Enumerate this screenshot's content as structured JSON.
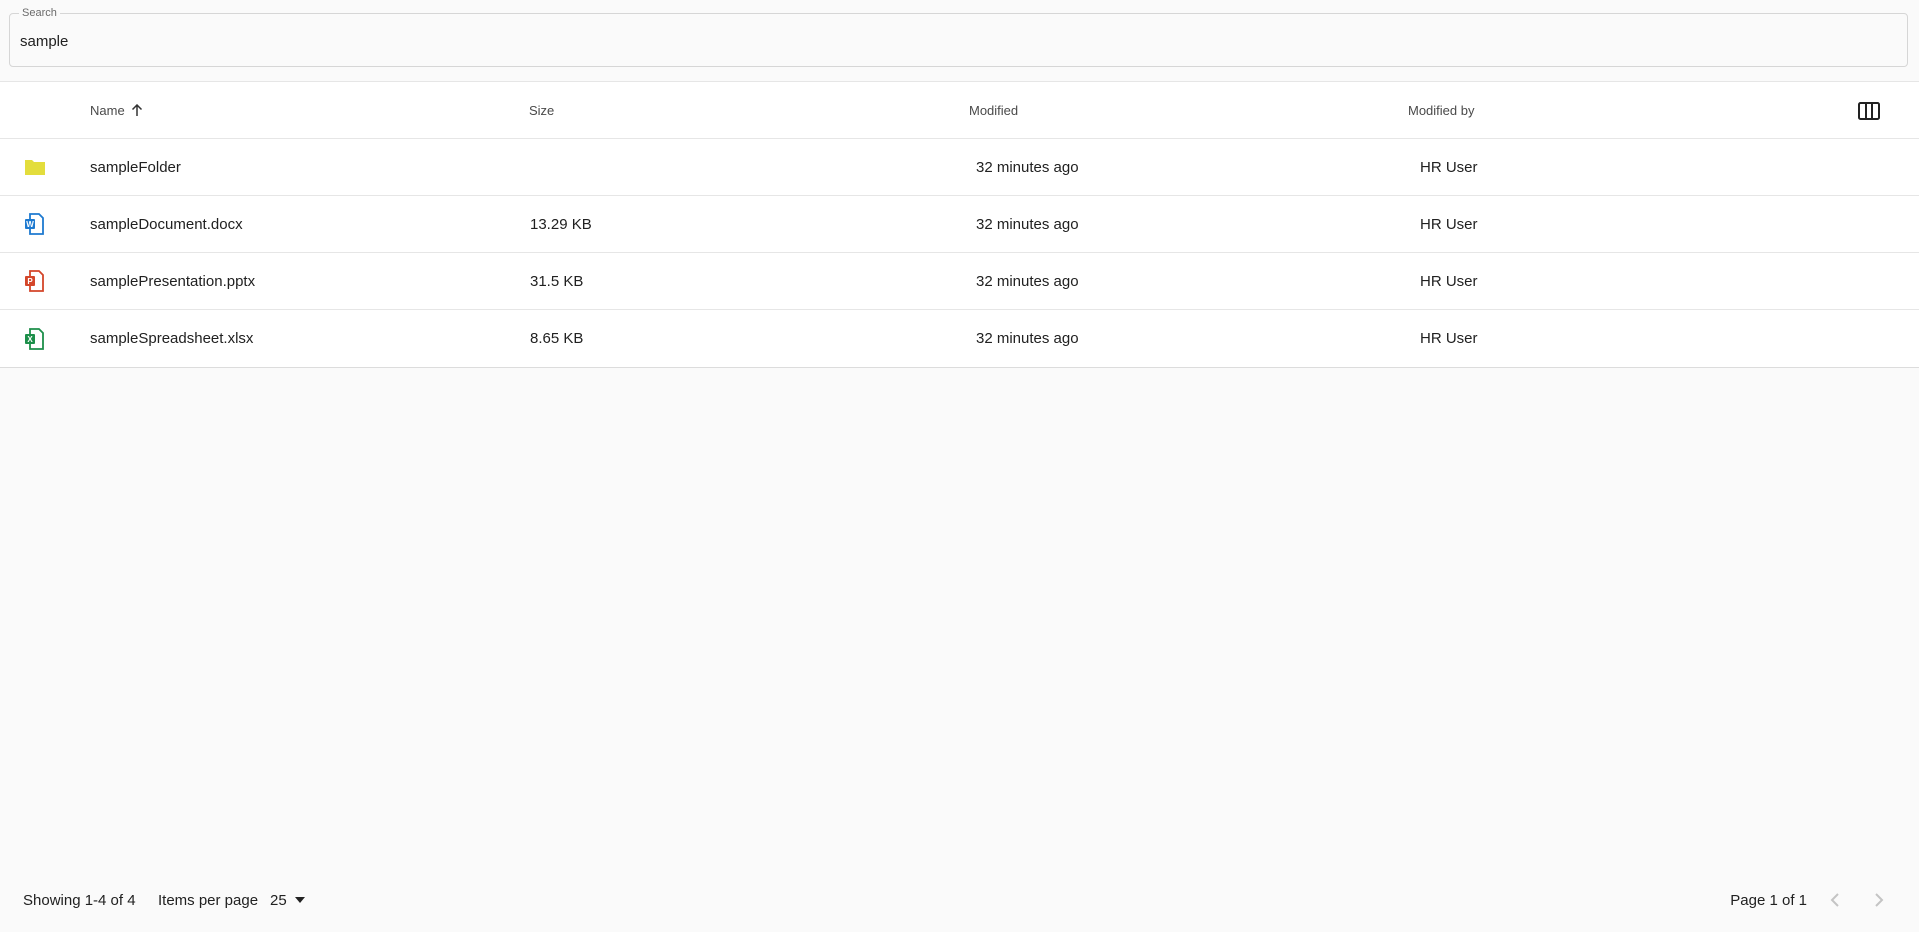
{
  "search": {
    "label": "Search",
    "value": "sample"
  },
  "table": {
    "columns": {
      "name": "Name",
      "size": "Size",
      "modified": "Modified",
      "modified_by": "Modified by"
    },
    "sort": {
      "column": "Name",
      "direction": "ascending"
    },
    "rows": [
      {
        "icon": "folder-icon",
        "name": "sampleFolder",
        "size": "",
        "modified": "32 minutes ago",
        "modified_by": "HR User"
      },
      {
        "icon": "word-document-icon",
        "name": "sampleDocument.docx",
        "size": "13.29 KB",
        "modified": "32 minutes ago",
        "modified_by": "HR User"
      },
      {
        "icon": "powerpoint-icon",
        "name": "samplePresentation.pptx",
        "size": "31.5 KB",
        "modified": "32 minutes ago",
        "modified_by": "HR User"
      },
      {
        "icon": "excel-spreadsheet-icon",
        "name": "sampleSpreadsheet.xlsx",
        "size": "8.65 KB",
        "modified": "32 minutes ago",
        "modified_by": "HR User"
      }
    ]
  },
  "footer": {
    "range": "Showing 1-4 of 4",
    "items_per_page_label": "Items per page",
    "items_per_page": "25",
    "page_info": "Page 1 of 1"
  },
  "colors": {
    "folder": "#e3dd3c",
    "word": "#1e7ad0",
    "powerpoint": "#d4462a",
    "excel": "#1d8f4a",
    "background": "#fafafa"
  }
}
